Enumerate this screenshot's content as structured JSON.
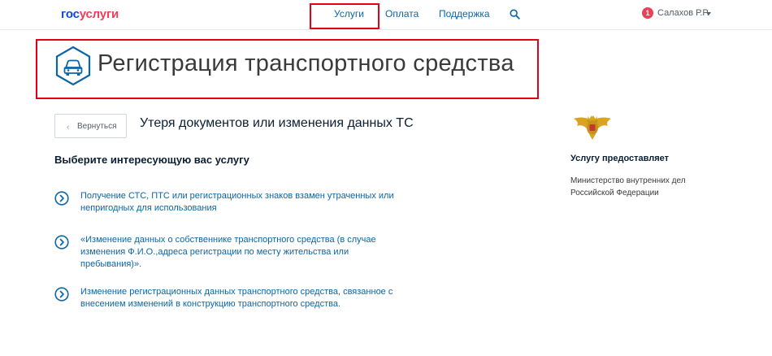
{
  "header": {
    "logo_part1": "гос",
    "logo_part2": "услуги",
    "nav": [
      {
        "label": "Услуги"
      },
      {
        "label": "Оплата"
      },
      {
        "label": "Поддержка"
      }
    ],
    "notification_count": "1",
    "user_name": "Салахов Р.Р."
  },
  "page": {
    "title": "Регистрация транспортного средства",
    "back_label": "Вернуться",
    "section_title": "Утеря документов или изменения данных ТС",
    "choose_label": "Выберите интересующую вас услугу",
    "services": [
      {
        "text": "Получение СТС, ПТС или регистрационных знаков взамен утраченных или непригодных для использования"
      },
      {
        "text": "«Изменение данных о собственнике транспортного средства (в случае изменения Ф.И.О.,адреса регистрации по месту жительства или пребывания)»."
      },
      {
        "text": "Изменение регистрационных данных транспортного средства, связанное с внесением изменений в конструкцию транспортного средства."
      }
    ]
  },
  "provider": {
    "title": "Услугу предоставляет",
    "name": "Министерство внутренних дел Российской Федерации"
  },
  "colors": {
    "link": "#0a66a8",
    "brand_blue": "#0d4cd3",
    "brand_red": "#ee3f58",
    "highlight": "#e3001b"
  },
  "icons": {
    "search": "search-icon",
    "back": "chevron-left-icon",
    "service": "chevron-right-circle-icon",
    "car": "car-icon",
    "emblem": "double-headed-eagle-emblem"
  }
}
